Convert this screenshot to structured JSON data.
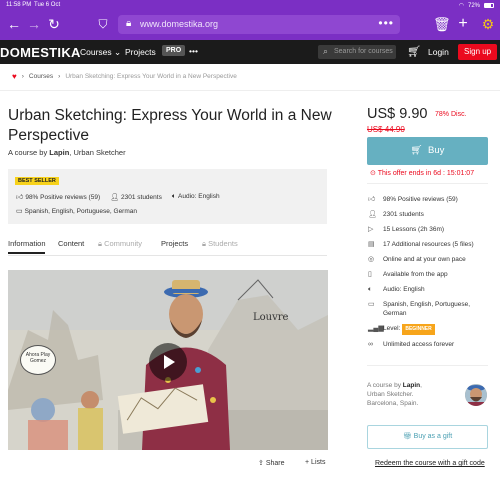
{
  "status_bar": {
    "time": "11:58 PM",
    "date": "Tue 6 Oct",
    "battery": "72%",
    "battery_level": 0.72
  },
  "browser": {
    "url": "www.domestika.org",
    "icons": [
      "back-arrow-icon",
      "forward-arrow-icon",
      "reload-icon",
      "shield-icon",
      "lock-icon",
      "more-dots-icon",
      "trash-icon",
      "plus-icon",
      "gear-icon"
    ]
  },
  "nav": {
    "logo": "DOMESTIKA",
    "courses": "Courses",
    "projects": "Projects",
    "pro": "PRO",
    "more": "•••",
    "search_placeholder": "Search for courses",
    "login": "Login",
    "signup": "Sign up"
  },
  "breadcrumb": {
    "courses": "Courses",
    "current": "Urban Sketching: Express Your World in a New Perspective"
  },
  "course": {
    "title": "Urban Sketching: Express Your World in a New Perspective",
    "byline_prefix": "A course by",
    "author": "Lapin",
    "author_role": ", Urban Sketcher",
    "badge": "BEST SELLER",
    "reviews": "98% Positive reviews (59)",
    "students": "2301 students",
    "audio": "Audio: English",
    "subtitles": "Spanish, English, Portuguese, German"
  },
  "tabs": {
    "information": "Information",
    "content": "Content",
    "community": "Community",
    "projects": "Projects",
    "students": "Students"
  },
  "video": {
    "sign_text": "Louvre",
    "speech_bubble": "Ahora Play Gomez"
  },
  "actions": {
    "share": "Share",
    "lists": "Lists"
  },
  "sidebar": {
    "price": "US$ 9.90",
    "discount": "78% Disc.",
    "old_price": "US$ 44.90",
    "buy": "Buy",
    "offer": "This offer ends in 6d : 15:01:07",
    "features": {
      "reviews": "98% Positive reviews (59)",
      "students": "2301 students",
      "lessons": "15 Lessons (2h 36m)",
      "resources": "17 Additional resources (5 files)",
      "online": "Online and at your own pace",
      "app": "Available from the app",
      "audio": "Audio: English",
      "subtitles": "Spanish, English, Portuguese, German",
      "level_label": "Level:",
      "level": "BEGINNER",
      "access": "Unlimited access forever"
    },
    "author_prefix": "A course by",
    "author": "Lapin",
    "author_role": "Urban Sketcher.",
    "author_location": "Barcelona, Spain.",
    "gift": "Buy as a gift",
    "redeem": "Redeem the course with a gift code"
  },
  "colors": {
    "browser": "#7b2fc4",
    "nav": "#1b1b1b",
    "accent_red": "#eb0a1e",
    "buy": "#66b0c1",
    "badge_yellow": "#f7d21b",
    "level_orange": "#f7a51b"
  }
}
